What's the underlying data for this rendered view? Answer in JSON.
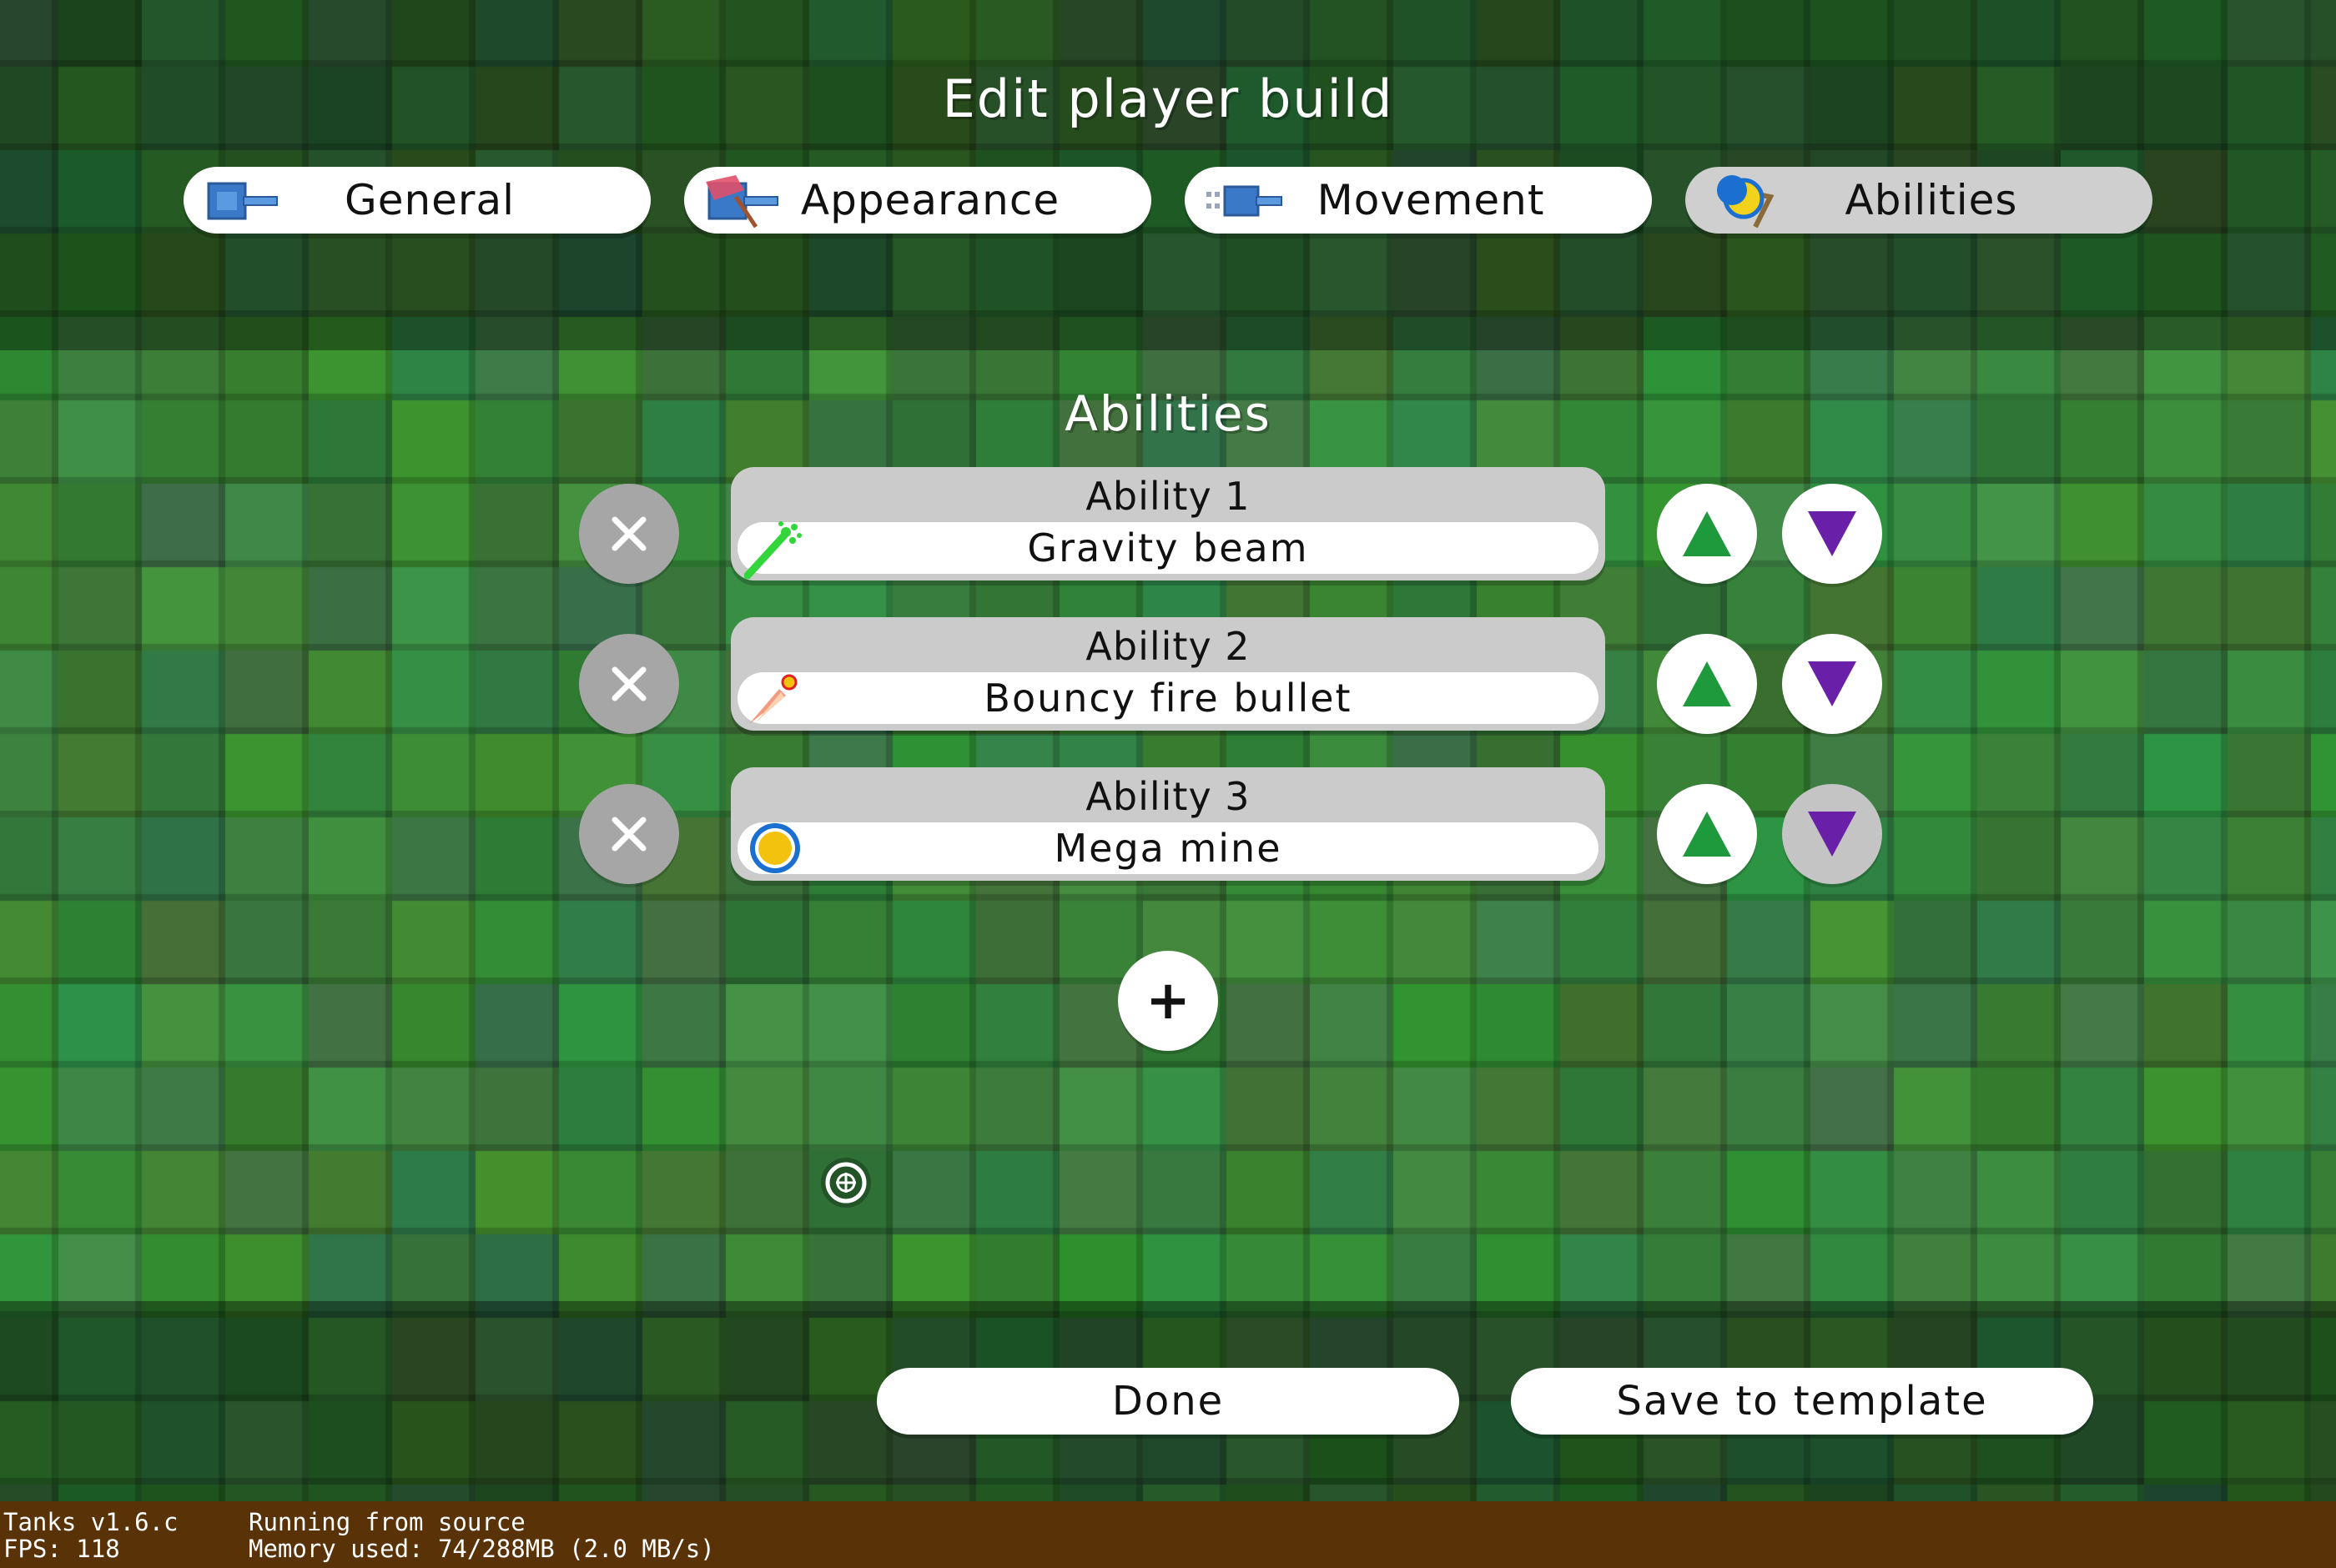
{
  "header": {
    "title": "Edit player build",
    "tabs": [
      {
        "label": "General",
        "icon": "tank-icon",
        "selected": false
      },
      {
        "label": "Appearance",
        "icon": "paint-tank-icon",
        "selected": false
      },
      {
        "label": "Movement",
        "icon": "moving-tank-icon",
        "selected": false
      },
      {
        "label": "Abilities",
        "icon": "abilities-icon",
        "selected": true
      }
    ]
  },
  "abilities": {
    "title": "Abilities",
    "items": [
      {
        "slot": "Ability 1",
        "value": "Gravity beam",
        "icon": "gravity-beam-icon",
        "up_enabled": true,
        "down_enabled": true
      },
      {
        "slot": "Ability 2",
        "value": "Bouncy fire bullet",
        "icon": "fire-bullet-icon",
        "up_enabled": true,
        "down_enabled": true
      },
      {
        "slot": "Ability 3",
        "value": "Mega mine",
        "icon": "mine-icon",
        "up_enabled": true,
        "down_enabled": false
      }
    ],
    "add_label": "+"
  },
  "footer": {
    "done_label": "Done",
    "save_label": "Save to template"
  },
  "status": {
    "version": "Tanks v1.6.c",
    "fps": "FPS: 118",
    "source": "Running from source",
    "memory": "Memory used: 74/288MB (2.0 MB/s)"
  },
  "colors": {
    "up_arrow": "#1e9a3c",
    "down_arrow": "#6a1fa8",
    "remove_button": "#a6a6a6",
    "status_bar": "#5a3208",
    "background_green": "#3d8a3a"
  }
}
